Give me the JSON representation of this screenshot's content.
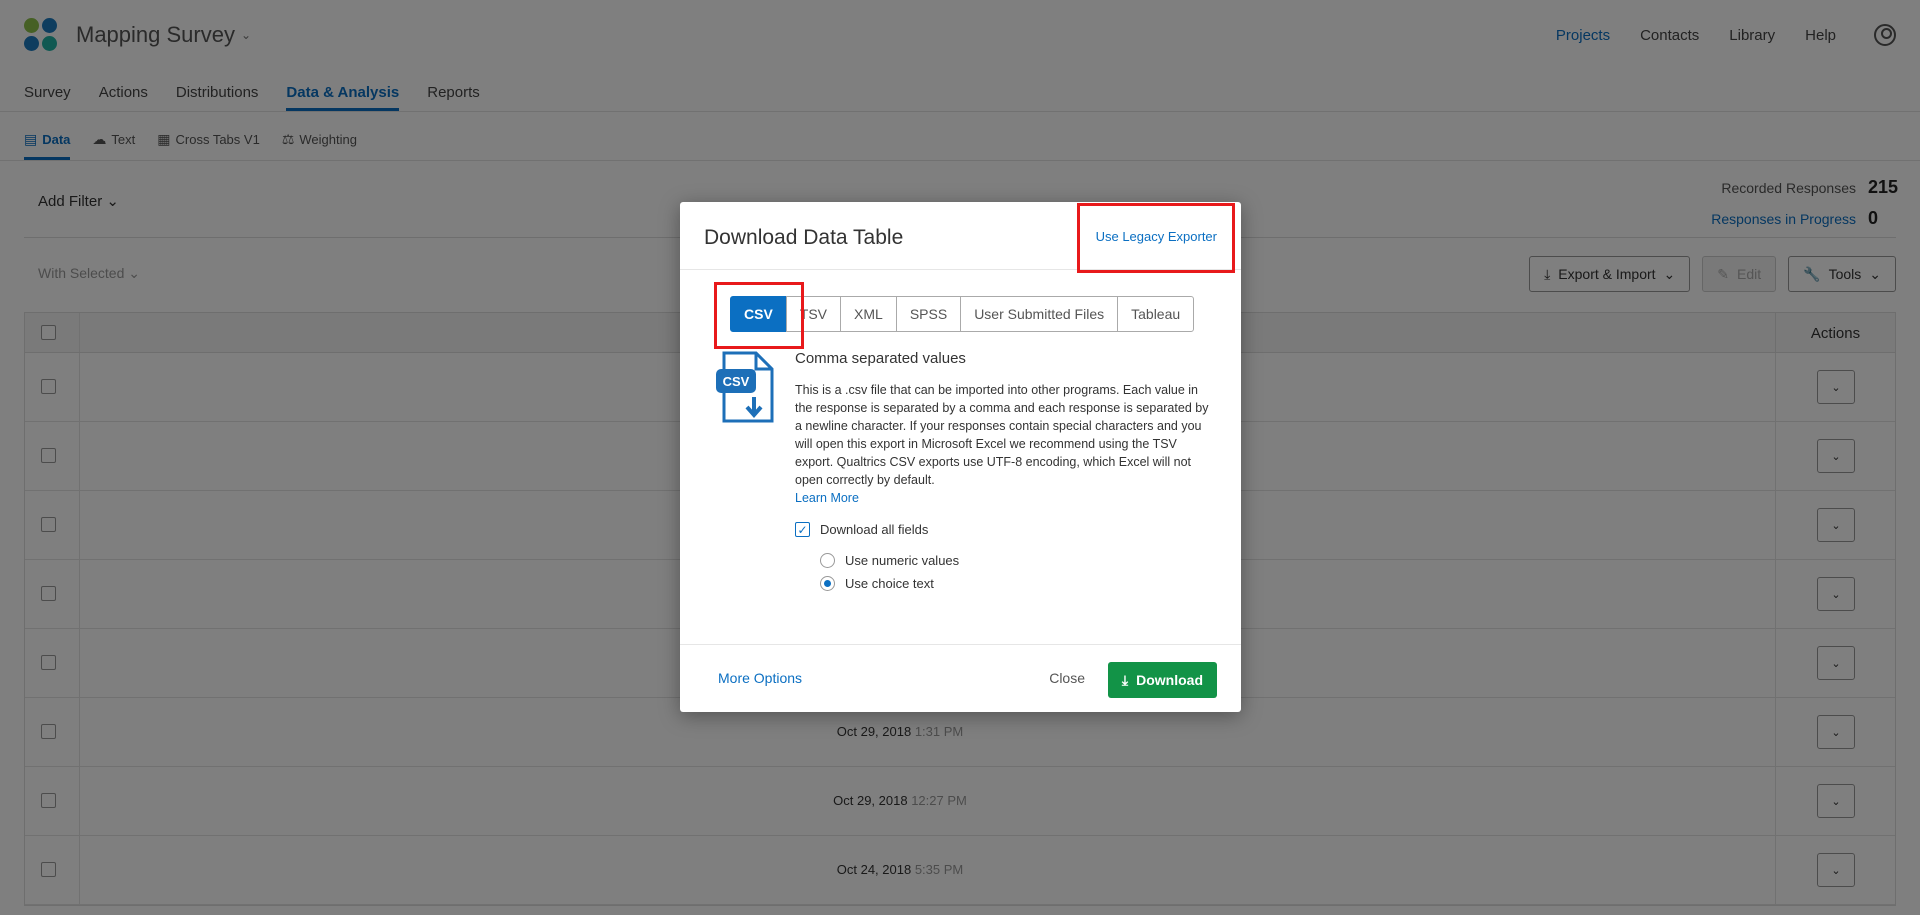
{
  "app": {
    "project_title": "Mapping Survey",
    "top_nav": [
      "Projects",
      "Contacts",
      "Library",
      "Help"
    ]
  },
  "tabs": [
    "Survey",
    "Actions",
    "Distributions",
    "Data & Analysis",
    "Reports"
  ],
  "subtabs": [
    "Data",
    "Text",
    "Cross Tabs V1",
    "Weighting"
  ],
  "filter": {
    "add_filter": "Add Filter"
  },
  "stats": {
    "recorded_label": "Recorded Responses",
    "recorded_value": "215",
    "in_progress_label": "Responses in Progress",
    "in_progress_value": "0"
  },
  "toolbar": {
    "with_selected": "With Selected",
    "export_import": "Export & Import",
    "edit": "Edit",
    "tools": "Tools"
  },
  "table": {
    "actions_header": "Actions",
    "rows": [
      {
        "date": "",
        "time": ""
      },
      {
        "date": "",
        "time": ""
      },
      {
        "date": "",
        "time": ""
      },
      {
        "date": "",
        "time": ""
      },
      {
        "date": "",
        "time": ""
      },
      {
        "date": "Oct 29, 2018",
        "time": "1:31 PM"
      },
      {
        "date": "Oct 29, 2018",
        "time": "12:27 PM"
      },
      {
        "date": "Oct 24, 2018",
        "time": "5:35 PM"
      }
    ]
  },
  "modal": {
    "title": "Download Data Table",
    "legacy_link": "Use Legacy Exporter",
    "formats": [
      "CSV",
      "TSV",
      "XML",
      "SPSS",
      "User Submitted Files",
      "Tableau"
    ],
    "selected_format": "CSV",
    "icon_label": "CSV",
    "format_name": "Comma separated values",
    "format_description": "This is a .csv file that can be imported into other programs. Each value in the response is separated by a comma and each response is separated by a newline character. If your responses contain special characters and you will open this export in Microsoft Excel we recommend using the TSV export. Qualtrics CSV exports use UTF-8 encoding, which Excel will not open correctly by default.",
    "learn_more": "Learn More",
    "download_all_fields": "Download all fields",
    "use_numeric": "Use numeric values",
    "use_choice": "Use choice text",
    "more_options": "More Options",
    "close": "Close",
    "download": "Download"
  },
  "colors": {
    "accent": "#0b6fc2",
    "download_green": "#129347",
    "highlight_red": "#e8191b"
  }
}
